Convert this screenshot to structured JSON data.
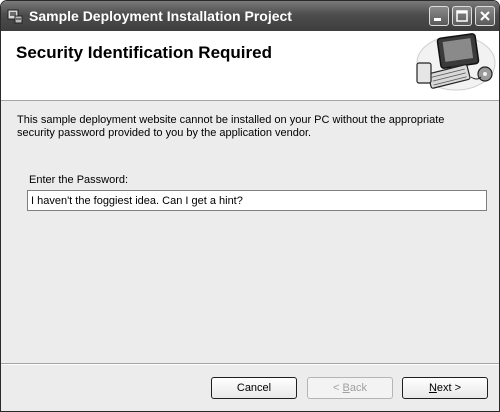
{
  "window": {
    "title": "Sample Deployment Installation Project"
  },
  "header": {
    "title": "Security Identification Required"
  },
  "body": {
    "description": "This sample deployment website cannot be installed on your PC without the appropriate security password provided to you by the application vendor.",
    "password_label": "Enter the Password:",
    "password_value": "I haven't the foggiest idea. Can I get a hint?"
  },
  "buttons": {
    "cancel": "Cancel",
    "back_prefix": "< ",
    "back_accel": "B",
    "back_rest": "ack",
    "next_accel": "N",
    "next_rest": "ext >"
  }
}
